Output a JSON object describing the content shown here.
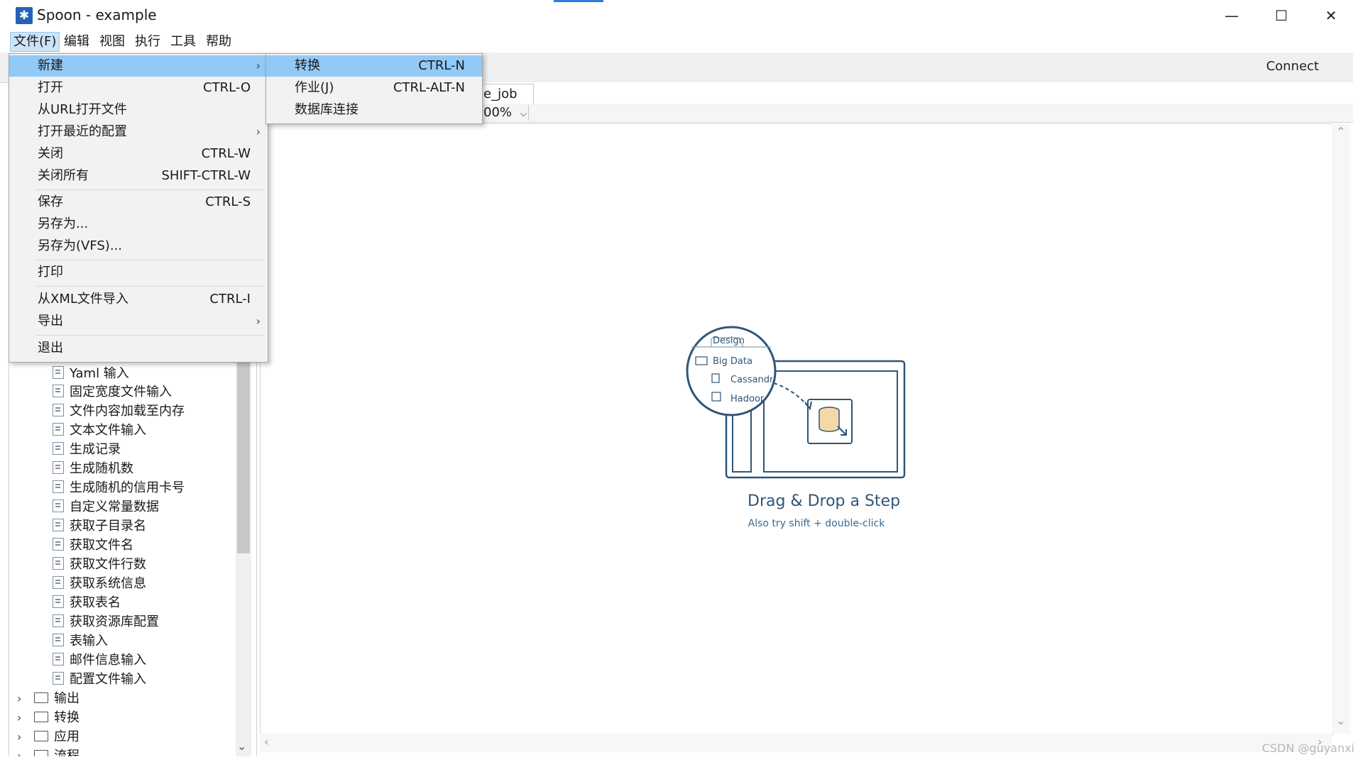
{
  "window": {
    "title": "Spoon - example",
    "minimize": "—",
    "maximize": "☐",
    "close": "✕"
  },
  "menubar": [
    "文件(F)",
    "编辑",
    "视图",
    "执行",
    "工具",
    "帮助"
  ],
  "toolbar": {
    "connect": "Connect"
  },
  "file_menu": [
    {
      "label": "新建",
      "shortcut": "",
      "submenu": true
    },
    {
      "label": "打开",
      "shortcut": "CTRL-O"
    },
    {
      "label": "从URL打开文件",
      "shortcut": ""
    },
    {
      "label": "打开最近的配置",
      "shortcut": "",
      "submenu": true
    },
    {
      "label": "关闭",
      "shortcut": "CTRL-W"
    },
    {
      "label": "关闭所有",
      "shortcut": "SHIFT-CTRL-W"
    },
    {
      "label": "保存",
      "shortcut": "CTRL-S"
    },
    {
      "label": "另存为...",
      "shortcut": ""
    },
    {
      "label": "另存为(VFS)...",
      "shortcut": ""
    },
    {
      "label": "打印",
      "shortcut": ""
    },
    {
      "label": "从XML文件导入",
      "shortcut": "CTRL-I"
    },
    {
      "label": "导出",
      "shortcut": "",
      "submenu": true
    },
    {
      "label": "退出",
      "shortcut": ""
    }
  ],
  "new_submenu": [
    {
      "label": "转换",
      "shortcut": "CTRL-N"
    },
    {
      "label": "作业(J)",
      "shortcut": "CTRL-ALT-N"
    },
    {
      "label": "数据库连接",
      "shortcut": ""
    }
  ],
  "tab": {
    "label": "e_job"
  },
  "zoom": {
    "value": "00%",
    "caret": "⌵"
  },
  "tree": {
    "steps": [
      "Yaml 输入",
      "固定宽度文件输入",
      "文件内容加载至内存",
      "文本文件输入",
      "生成记录",
      "生成随机数",
      "生成随机的信用卡号",
      "自定义常量数据",
      "获取子目录名",
      "获取文件名",
      "获取文件行数",
      "获取系统信息",
      "获取表名",
      "获取资源库配置",
      "表输入",
      "邮件信息输入",
      "配置文件输入"
    ],
    "folders": [
      "输出",
      "转换",
      "应用",
      "流程"
    ]
  },
  "canvas": {
    "illustration": {
      "tab_label": "Design",
      "folder_label": "Big Data",
      "item1": "Cassandr",
      "item2": "Hadoop"
    },
    "heading": "Drag & Drop a Step",
    "subheading": "Also try shift + double-click"
  },
  "watermark": "CSDN @guyanxi",
  "colors": {
    "highlight": "#91c9f7",
    "accent": "#2b7de0",
    "illustration": "#2f5577"
  }
}
